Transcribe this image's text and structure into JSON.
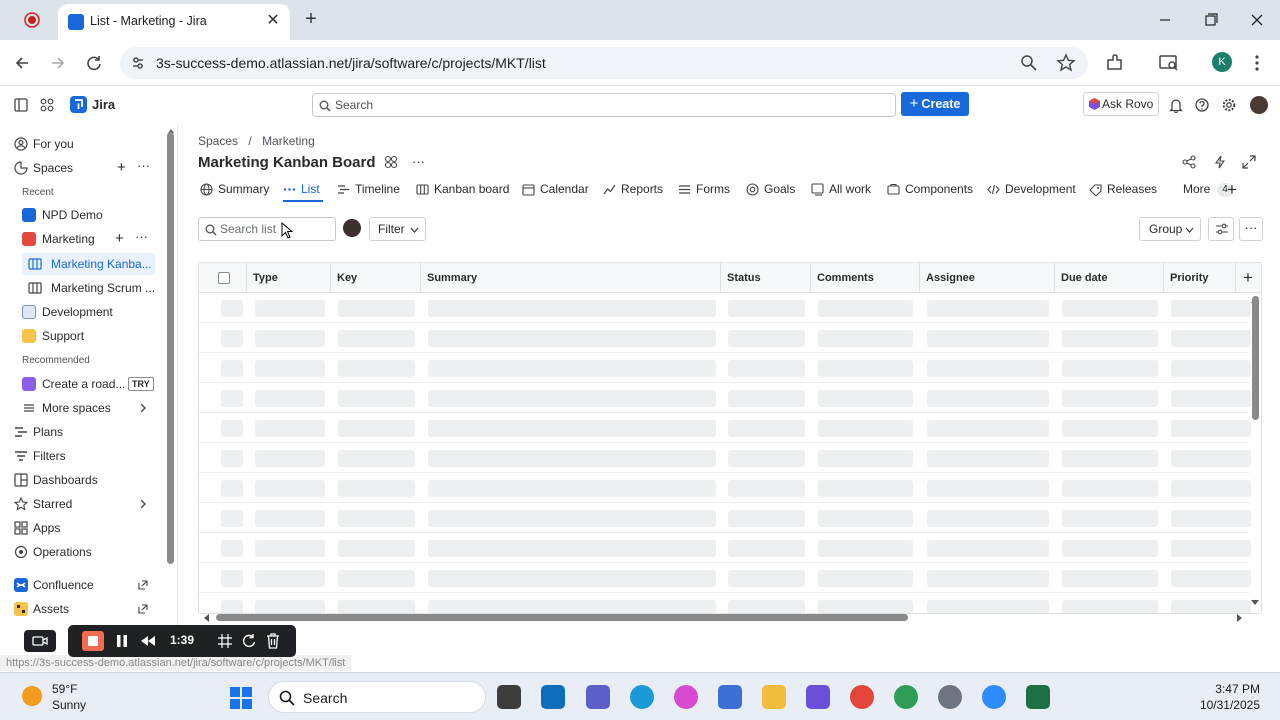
{
  "browser": {
    "tab_title": "List - Marketing - Jira",
    "tab_close": "✕",
    "new_tab": "+",
    "url": "3s-success-demo.atlassian.net/jira/software/c/projects/MKT/list",
    "profile_initial": "K",
    "status_url": "https://3s-success-demo.atlassian.net/jira/software/c/projects/MKT/list"
  },
  "jira": {
    "app_name": "Jira",
    "search_placeholder": "Search",
    "create_label": "Create",
    "ask_rovo_label": "Ask Rovo"
  },
  "sidebar": {
    "for_you": "For you",
    "spaces": "Spaces",
    "recent_header": "Recent",
    "recent": [
      "NPD Demo",
      "Marketing"
    ],
    "marketing_children": [
      "Marketing Kanba...",
      "Marketing Scrum ..."
    ],
    "more_recent": [
      "Development",
      "Support"
    ],
    "recommended_header": "Recommended",
    "recommended_item": "Create a road...",
    "try_badge": "TRY",
    "more_spaces": "More spaces",
    "nav": [
      "Plans",
      "Filters",
      "Dashboards",
      "Starred",
      "Apps",
      "Operations"
    ],
    "apps": [
      "Confluence",
      "Assets"
    ]
  },
  "main": {
    "breadcrumb": [
      "Spaces",
      "Marketing"
    ],
    "breadcrumb_sep": "/",
    "board_title": "Marketing Kanban Board",
    "tabs": [
      {
        "label": "Summary",
        "icon": "globe-icon"
      },
      {
        "label": "List",
        "icon": "list-dots-icon"
      },
      {
        "label": "Timeline",
        "icon": "timeline-icon"
      },
      {
        "label": "Kanban board",
        "icon": "board-icon"
      },
      {
        "label": "Calendar",
        "icon": "calendar-icon"
      },
      {
        "label": "Reports",
        "icon": "reports-icon"
      },
      {
        "label": "Forms",
        "icon": "forms-icon"
      },
      {
        "label": "Goals",
        "icon": "goals-icon"
      },
      {
        "label": "All work",
        "icon": "all-work-icon"
      },
      {
        "label": "Components",
        "icon": "components-icon"
      },
      {
        "label": "Development",
        "icon": "code-icon"
      },
      {
        "label": "Releases",
        "icon": "releases-icon"
      }
    ],
    "more_label": "More",
    "more_count": "4",
    "search_list_placeholder": "Search list",
    "filter_label": "Filter",
    "group_label": "Group",
    "columns": [
      "Type",
      "Key",
      "Summary",
      "Status",
      "Comments",
      "Assignee",
      "Due date",
      "Priority"
    ]
  },
  "recorder": {
    "elapsed": "1:39"
  },
  "taskbar": {
    "temperature": "59°F",
    "weather": "Sunny",
    "search_label": "Search",
    "time": "3:47 PM",
    "date": "10/31/2025"
  },
  "colors": {
    "brand_blue": "#1868db",
    "active_bg": "#e9f2fe"
  }
}
